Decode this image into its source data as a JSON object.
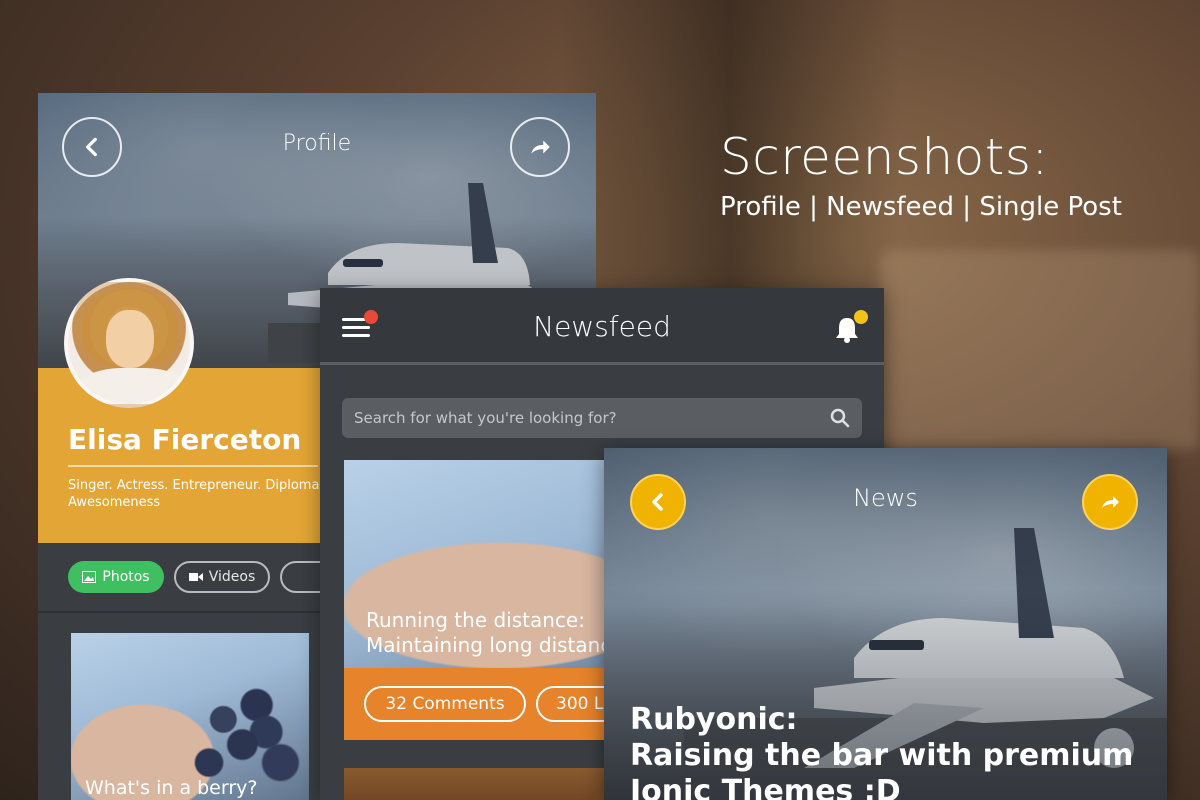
{
  "header": {
    "title": "Screenshots:",
    "subtitle": "Profile | Newsfeed | Single Post"
  },
  "profile": {
    "title": "Profile",
    "name": "Elisa Fierceton",
    "bio": "Singer. Actress. Entrepreneur. Diploma Awesomeness",
    "tabs": [
      {
        "label": "Photos",
        "icon": "image-icon",
        "active": true
      },
      {
        "label": "Videos",
        "icon": "video-icon",
        "active": false
      }
    ],
    "post_caption": "What's in a berry?",
    "colors": {
      "accent": "#e3a535",
      "active_tab": "#3fbf5f"
    }
  },
  "newsfeed": {
    "title": "Newsfeed",
    "search_placeholder": "Search for what you're looking for?",
    "post_title_line1": "Running the distance:",
    "post_title_line2": "Maintaining long distance",
    "comments_label": "32 Comments",
    "likes_label": "300 L",
    "colors": {
      "menu_badge": "#e84a3a",
      "bell_badge": "#f0c419",
      "action_bar": "#e6832b"
    }
  },
  "news": {
    "title": "News",
    "headline_line1": "Rubyonic:",
    "headline_line2": "Raising the bar with premium",
    "headline_line3": "Ionic Themes :D",
    "colors": {
      "button": "#f0b400"
    }
  }
}
